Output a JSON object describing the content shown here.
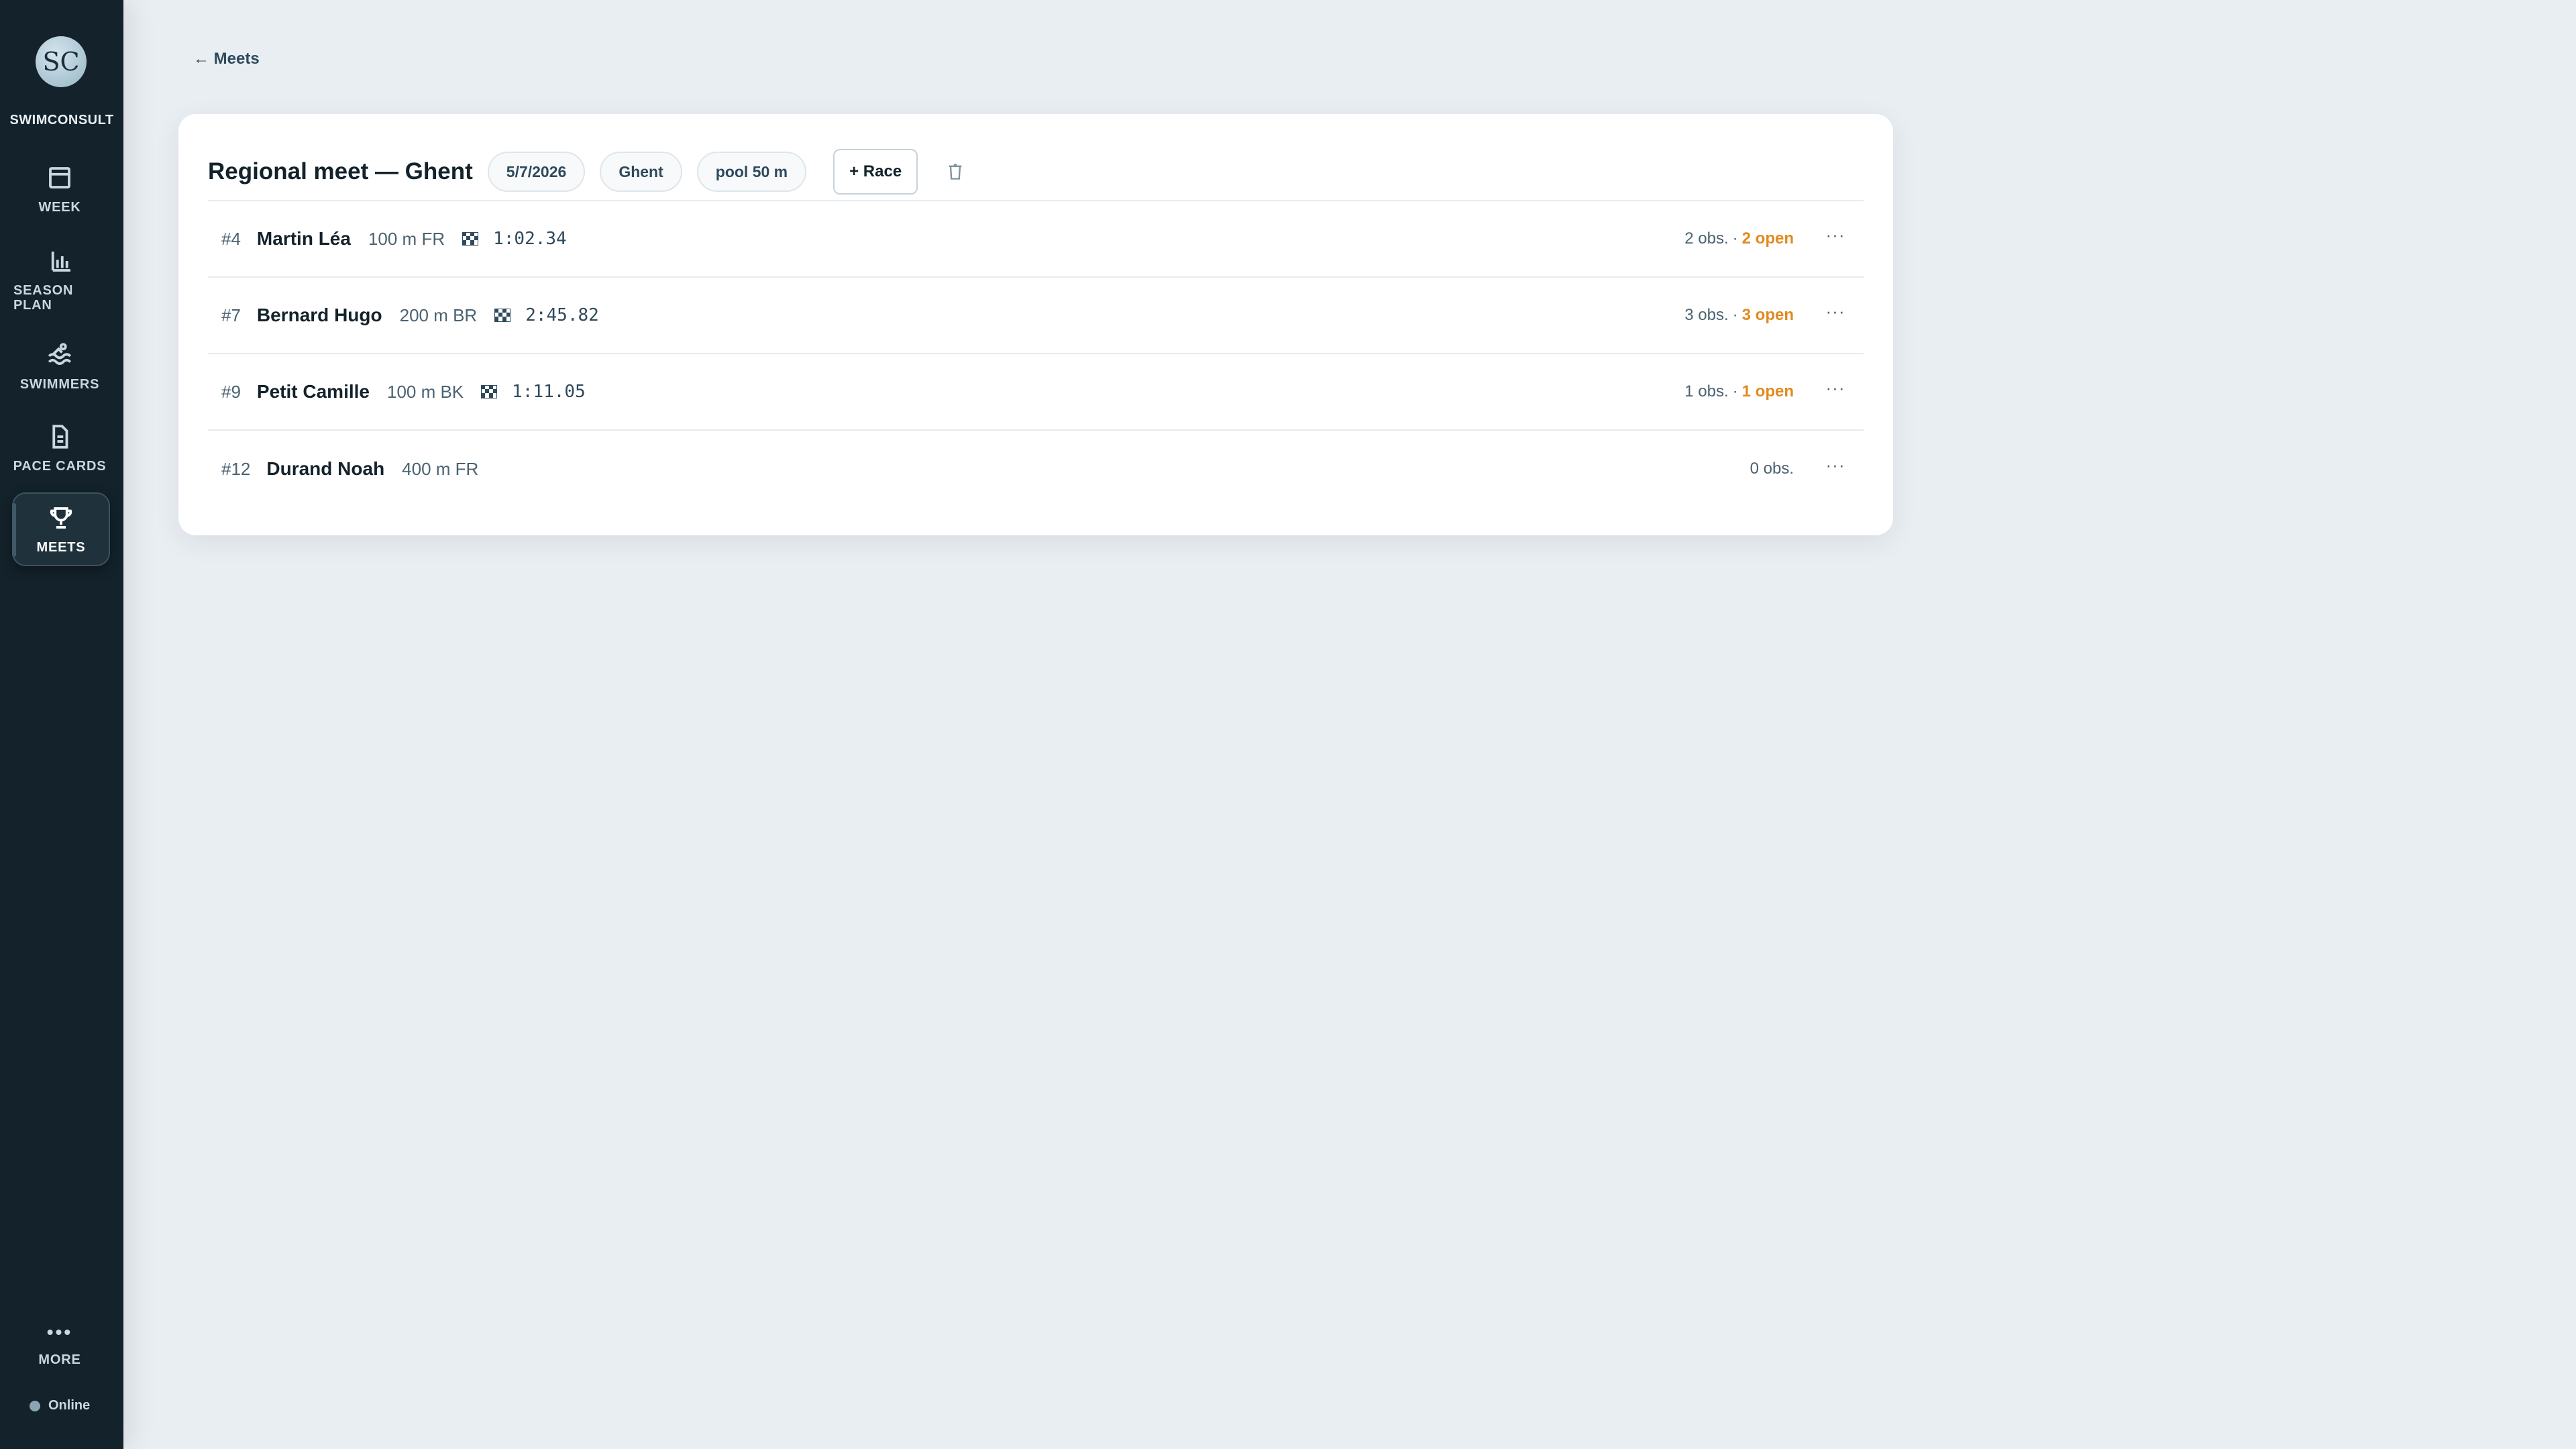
{
  "sidebar": {
    "logo_text": "SC",
    "brand": "SWIMCONSULT",
    "items": [
      {
        "label": "WEEK",
        "icon": "calendar-icon"
      },
      {
        "label": "SEASON PLAN",
        "icon": "bar-chart-icon"
      },
      {
        "label": "SWIMMERS",
        "icon": "swimmer-icon"
      },
      {
        "label": "PACE CARDS",
        "icon": "document-icon"
      },
      {
        "label": "MEETS",
        "icon": "trophy-icon",
        "active": true
      }
    ],
    "more": {
      "label": "MORE",
      "icon": "more-dots-icon"
    },
    "status": "Online"
  },
  "back_link": "← Meets",
  "meet": {
    "title": "Regional meet — Ghent",
    "date": "5/7/2026",
    "location": "Ghent",
    "pool": "pool 50 m",
    "add_race_label": "+ Race",
    "delete_icon": "trash-icon"
  },
  "races": [
    {
      "bib": "#4",
      "name": "Martin Léa",
      "event": "100 m FR",
      "time": "1:02.34",
      "obs": "2 obs.",
      "open": "2 open"
    },
    {
      "bib": "#7",
      "name": "Bernard Hugo",
      "event": "200 m BR",
      "time": "2:45.82",
      "obs": "3 obs.",
      "open": "3 open"
    },
    {
      "bib": "#9",
      "name": "Petit Camille",
      "event": "100 m BK",
      "time": "1:11.05",
      "obs": "1 obs.",
      "open": "1 open"
    },
    {
      "bib": "#12",
      "name": "Durand Noah",
      "event": "400 m FR",
      "time": "",
      "obs": "0 obs.",
      "open": ""
    }
  ],
  "colors": {
    "sidebar": "#13222b",
    "accent_open": "#e08a1e",
    "background": "#e9eef2"
  }
}
